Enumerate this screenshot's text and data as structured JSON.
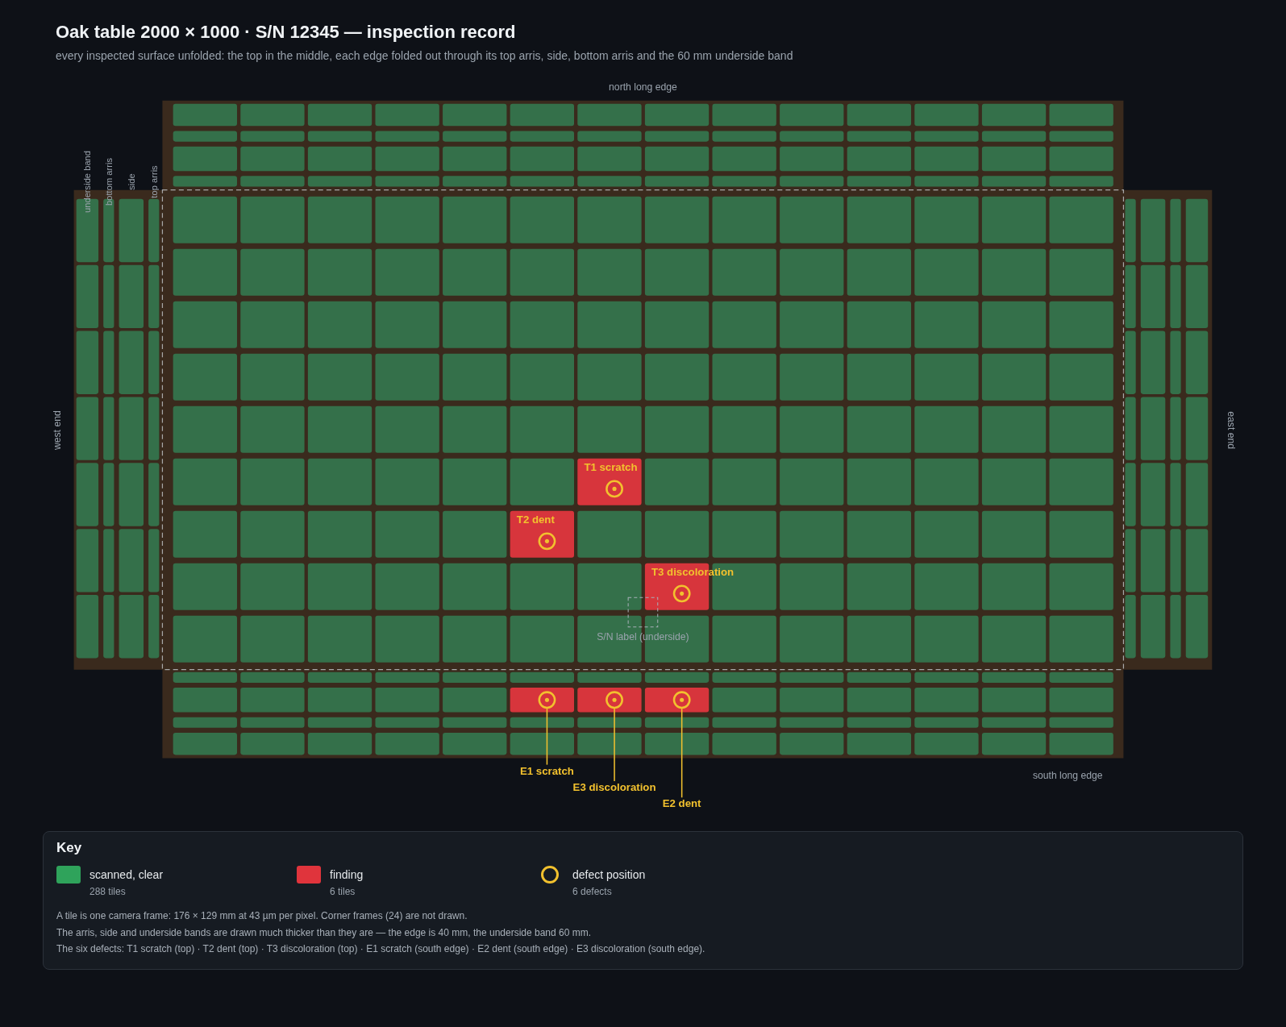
{
  "title": "Oak table 2000 × 1000 · S/N 12345 — inspection record",
  "subtitle": "every inspected surface unfolded: the top in the middle, each edge folded out through its top arris, side, bottom arris and the 60 mm underside band",
  "edge_labels": {
    "north": "north long edge",
    "south": "south long edge",
    "west": "west end",
    "east": "east end"
  },
  "serial_label": {
    "text": "S/N label (underside)"
  },
  "top": {
    "rows": [
      [
        {
          "finding": false
        },
        {
          "finding": false
        },
        {
          "finding": false
        },
        {
          "finding": false
        },
        {
          "finding": false
        },
        {
          "finding": false
        },
        {
          "finding": false
        },
        {
          "finding": false
        },
        {
          "finding": false
        },
        {
          "finding": false
        },
        {
          "finding": false
        },
        {
          "finding": false
        },
        {
          "finding": false
        },
        {
          "finding": false
        }
      ],
      [
        {
          "finding": false
        },
        {
          "finding": false
        },
        {
          "finding": false
        },
        {
          "finding": false
        },
        {
          "finding": false
        },
        {
          "finding": false
        },
        {
          "finding": false
        },
        {
          "finding": false
        },
        {
          "finding": false
        },
        {
          "finding": false
        },
        {
          "finding": false
        },
        {
          "finding": false
        },
        {
          "finding": false
        },
        {
          "finding": false
        }
      ],
      [
        {
          "finding": false
        },
        {
          "finding": false
        },
        {
          "finding": false
        },
        {
          "finding": false
        },
        {
          "finding": false
        },
        {
          "finding": false
        },
        {
          "finding": false
        },
        {
          "finding": false
        },
        {
          "finding": false
        },
        {
          "finding": false
        },
        {
          "finding": false
        },
        {
          "finding": false
        },
        {
          "finding": false
        },
        {
          "finding": false
        }
      ],
      [
        {
          "finding": false
        },
        {
          "finding": false
        },
        {
          "finding": false
        },
        {
          "finding": false
        },
        {
          "finding": false
        },
        {
          "finding": false
        },
        {
          "finding": false
        },
        {
          "finding": false
        },
        {
          "finding": false
        },
        {
          "finding": false
        },
        {
          "finding": false
        },
        {
          "finding": false
        },
        {
          "finding": false
        },
        {
          "finding": false
        }
      ],
      [
        {
          "finding": false
        },
        {
          "finding": false
        },
        {
          "finding": false
        },
        {
          "finding": false
        },
        {
          "finding": false
        },
        {
          "finding": false
        },
        {
          "finding": false
        },
        {
          "finding": false
        },
        {
          "finding": false
        },
        {
          "finding": false
        },
        {
          "finding": false
        },
        {
          "finding": false
        },
        {
          "finding": false
        },
        {
          "finding": false
        }
      ],
      [
        {
          "finding": false
        },
        {
          "finding": false
        },
        {
          "finding": false
        },
        {
          "finding": false
        },
        {
          "finding": false
        },
        {
          "finding": false
        },
        {
          "finding": true,
          "defect": "T1 scratch"
        },
        {
          "finding": false
        },
        {
          "finding": false
        },
        {
          "finding": false
        },
        {
          "finding": false
        },
        {
          "finding": false
        },
        {
          "finding": false
        },
        {
          "finding": false
        }
      ],
      [
        {
          "finding": false
        },
        {
          "finding": false
        },
        {
          "finding": false
        },
        {
          "finding": false
        },
        {
          "finding": false
        },
        {
          "finding": true,
          "defect": "T2 dent"
        },
        {
          "finding": false
        },
        {
          "finding": false
        },
        {
          "finding": false
        },
        {
          "finding": false
        },
        {
          "finding": false
        },
        {
          "finding": false
        },
        {
          "finding": false
        },
        {
          "finding": false
        }
      ],
      [
        {
          "finding": false
        },
        {
          "finding": false
        },
        {
          "finding": false
        },
        {
          "finding": false
        },
        {
          "finding": false
        },
        {
          "finding": false
        },
        {
          "finding": false
        },
        {
          "finding": true,
          "defect": "T3 discoloration"
        },
        {
          "finding": false
        },
        {
          "finding": false
        },
        {
          "finding": false
        },
        {
          "finding": false
        },
        {
          "finding": false
        },
        {
          "finding": false
        }
      ],
      [
        {
          "finding": false
        },
        {
          "finding": false
        },
        {
          "finding": false
        },
        {
          "finding": false
        },
        {
          "finding": false
        },
        {
          "finding": false
        },
        {
          "finding": false
        },
        {
          "finding": false
        },
        {
          "finding": false
        },
        {
          "finding": false
        },
        {
          "finding": false
        },
        {
          "finding": false
        },
        {
          "finding": false
        },
        {
          "finding": false
        }
      ]
    ]
  },
  "north": {
    "bands": [
      {
        "kind": "underside",
        "tiles": [
          {
            "finding": false
          },
          {
            "finding": false
          },
          {
            "finding": false
          },
          {
            "finding": false
          },
          {
            "finding": false
          },
          {
            "finding": false
          },
          {
            "finding": false
          },
          {
            "finding": false
          },
          {
            "finding": false
          },
          {
            "finding": false
          },
          {
            "finding": false
          },
          {
            "finding": false
          },
          {
            "finding": false
          },
          {
            "finding": false
          }
        ]
      },
      {
        "kind": "bottom_arris",
        "tiles": [
          {
            "finding": false
          },
          {
            "finding": false
          },
          {
            "finding": false
          },
          {
            "finding": false
          },
          {
            "finding": false
          },
          {
            "finding": false
          },
          {
            "finding": false
          },
          {
            "finding": false
          },
          {
            "finding": false
          },
          {
            "finding": false
          },
          {
            "finding": false
          },
          {
            "finding": false
          },
          {
            "finding": false
          },
          {
            "finding": false
          }
        ]
      },
      {
        "kind": "side",
        "tiles": [
          {
            "finding": false
          },
          {
            "finding": false
          },
          {
            "finding": false
          },
          {
            "finding": false
          },
          {
            "finding": false
          },
          {
            "finding": false
          },
          {
            "finding": false
          },
          {
            "finding": false
          },
          {
            "finding": false
          },
          {
            "finding": false
          },
          {
            "finding": false
          },
          {
            "finding": false
          },
          {
            "finding": false
          },
          {
            "finding": false
          }
        ]
      },
      {
        "kind": "top_arris",
        "tiles": [
          {
            "finding": false
          },
          {
            "finding": false
          },
          {
            "finding": false
          },
          {
            "finding": false
          },
          {
            "finding": false
          },
          {
            "finding": false
          },
          {
            "finding": false
          },
          {
            "finding": false
          },
          {
            "finding": false
          },
          {
            "finding": false
          },
          {
            "finding": false
          },
          {
            "finding": false
          },
          {
            "finding": false
          },
          {
            "finding": false
          }
        ]
      }
    ]
  },
  "south": {
    "bands": [
      {
        "kind": "top_arris",
        "tiles": [
          {
            "finding": false
          },
          {
            "finding": false
          },
          {
            "finding": false
          },
          {
            "finding": false
          },
          {
            "finding": false
          },
          {
            "finding": false
          },
          {
            "finding": false
          },
          {
            "finding": false
          },
          {
            "finding": false
          },
          {
            "finding": false
          },
          {
            "finding": false
          },
          {
            "finding": false
          },
          {
            "finding": false
          },
          {
            "finding": false
          }
        ]
      },
      {
        "kind": "side",
        "tiles": [
          {
            "finding": false
          },
          {
            "finding": false
          },
          {
            "finding": false
          },
          {
            "finding": false
          },
          {
            "finding": false
          },
          {
            "finding": true,
            "defect": "E1 scratch"
          },
          {
            "finding": true,
            "defect": "E3 discoloration"
          },
          {
            "finding": true,
            "defect": "E2 dent"
          },
          {
            "finding": false
          },
          {
            "finding": false
          },
          {
            "finding": false
          },
          {
            "finding": false
          },
          {
            "finding": false
          },
          {
            "finding": false
          }
        ]
      },
      {
        "kind": "bottom_arris",
        "tiles": [
          {
            "finding": false
          },
          {
            "finding": false
          },
          {
            "finding": false
          },
          {
            "finding": false
          },
          {
            "finding": false
          },
          {
            "finding": false
          },
          {
            "finding": false
          },
          {
            "finding": false
          },
          {
            "finding": false
          },
          {
            "finding": false
          },
          {
            "finding": false
          },
          {
            "finding": false
          },
          {
            "finding": false
          },
          {
            "finding": false
          }
        ]
      },
      {
        "kind": "underside",
        "tiles": [
          {
            "finding": false
          },
          {
            "finding": false
          },
          {
            "finding": false
          },
          {
            "finding": false
          },
          {
            "finding": false
          },
          {
            "finding": false
          },
          {
            "finding": false
          },
          {
            "finding": false
          },
          {
            "finding": false
          },
          {
            "finding": false
          },
          {
            "finding": false
          },
          {
            "finding": false
          },
          {
            "finding": false
          },
          {
            "finding": false
          }
        ]
      }
    ]
  },
  "west": {
    "bands": [
      {
        "kind": "underside",
        "label": "underside band",
        "tiles": [
          {
            "finding": false
          },
          {
            "finding": false
          },
          {
            "finding": false
          },
          {
            "finding": false
          },
          {
            "finding": false
          },
          {
            "finding": false
          },
          {
            "finding": false
          }
        ]
      },
      {
        "kind": "bottom_arris",
        "label": "bottom arris",
        "tiles": [
          {
            "finding": false
          },
          {
            "finding": false
          },
          {
            "finding": false
          },
          {
            "finding": false
          },
          {
            "finding": false
          },
          {
            "finding": false
          },
          {
            "finding": false
          }
        ]
      },
      {
        "kind": "side",
        "label": "side",
        "tiles": [
          {
            "finding": false
          },
          {
            "finding": false
          },
          {
            "finding": false
          },
          {
            "finding": false
          },
          {
            "finding": false
          },
          {
            "finding": false
          },
          {
            "finding": false
          }
        ]
      },
      {
        "kind": "top_arris",
        "label": "top arris",
        "tiles": [
          {
            "finding": false
          },
          {
            "finding": false
          },
          {
            "finding": false
          },
          {
            "finding": false
          },
          {
            "finding": false
          },
          {
            "finding": false
          },
          {
            "finding": false
          }
        ]
      }
    ]
  },
  "east": {
    "bands": [
      {
        "kind": "top_arris",
        "tiles": [
          {
            "finding": false
          },
          {
            "finding": false
          },
          {
            "finding": false
          },
          {
            "finding": false
          },
          {
            "finding": false
          },
          {
            "finding": false
          },
          {
            "finding": false
          }
        ]
      },
      {
        "kind": "side",
        "tiles": [
          {
            "finding": false
          },
          {
            "finding": false
          },
          {
            "finding": false
          },
          {
            "finding": false
          },
          {
            "finding": false
          },
          {
            "finding": false
          },
          {
            "finding": false
          }
        ]
      },
      {
        "kind": "bottom_arris",
        "tiles": [
          {
            "finding": false
          },
          {
            "finding": false
          },
          {
            "finding": false
          },
          {
            "finding": false
          },
          {
            "finding": false
          },
          {
            "finding": false
          },
          {
            "finding": false
          }
        ]
      },
      {
        "kind": "underside",
        "tiles": [
          {
            "finding": false
          },
          {
            "finding": false
          },
          {
            "finding": false
          },
          {
            "finding": false
          },
          {
            "finding": false
          },
          {
            "finding": false
          },
          {
            "finding": false
          }
        ]
      }
    ]
  },
  "key": {
    "title": "Key",
    "items": [
      {
        "kind": "clear",
        "label": "scanned, clear",
        "count": "288 tiles"
      },
      {
        "kind": "finding",
        "label": "finding",
        "count": "6 tiles"
      },
      {
        "kind": "defect",
        "label": "defect position",
        "count": "6 defects"
      }
    ],
    "notes": [
      "A tile is one camera frame: 176 × 129 mm at 43 µm per pixel. Corner frames (24) are not drawn.",
      "The arris, side and underside bands are drawn much thicker than they are — the edge is 40 mm, the underside band 60 mm.",
      "The six defects: T1 scratch (top) · T2 dent (top) · T3 discoloration (top) · E1 scratch (south edge) · E2 dent (south edge) · E3 discoloration (south edge)."
    ]
  }
}
